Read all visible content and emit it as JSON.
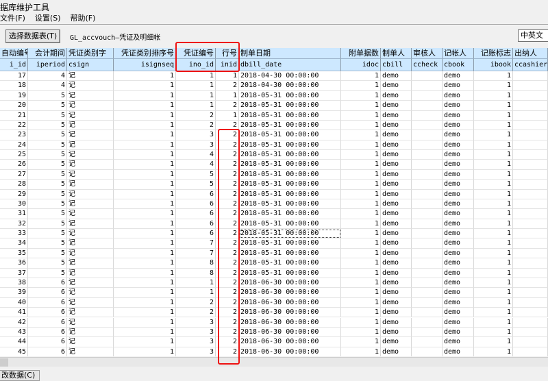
{
  "window": {
    "title": "据库维护工具"
  },
  "menu": [
    "文件(F)",
    "设置(S)",
    "帮助(F)"
  ],
  "toolbar": {
    "select_table": "选择数据表(T)",
    "table_name": "GL_accvouch—凭证及明细帐",
    "language": "中英文"
  },
  "columns": [
    {
      "cn": "自动编号",
      "en": "i_id",
      "align": "r"
    },
    {
      "cn": "会计期间",
      "en": "iperiod",
      "align": "r"
    },
    {
      "cn": "凭证类别字",
      "en": "csign",
      "align": "l"
    },
    {
      "cn": "凭证类别排序号",
      "en": "isignseq",
      "align": "r"
    },
    {
      "cn": "凭证编号",
      "en": "ino_id",
      "align": "r"
    },
    {
      "cn": "行号",
      "en": "inid",
      "align": "r"
    },
    {
      "cn": "制单日期",
      "en": "dbill_date",
      "align": "l"
    },
    {
      "cn": "附单据数",
      "en": "idoc",
      "align": "r"
    },
    {
      "cn": "制单人",
      "en": "cbill",
      "align": "l"
    },
    {
      "cn": "审核人",
      "en": "ccheck",
      "align": "l"
    },
    {
      "cn": "记帐人",
      "en": "cbook",
      "align": "l"
    },
    {
      "cn": "记账标志",
      "en": "ibook",
      "align": "r"
    },
    {
      "cn": "出纳人",
      "en": "ccashier",
      "align": "l"
    }
  ],
  "rows": [
    [
      "17",
      "4",
      "记",
      "1",
      "1",
      "1",
      "2018-04-30 00:00:00",
      "1",
      "demo",
      "",
      "demo",
      "1",
      ""
    ],
    [
      "18",
      "4",
      "记",
      "1",
      "1",
      "2",
      "2018-04-30 00:00:00",
      "1",
      "demo",
      "",
      "demo",
      "1",
      ""
    ],
    [
      "19",
      "5",
      "记",
      "1",
      "1",
      "1",
      "2018-05-31 00:00:00",
      "1",
      "demo",
      "",
      "demo",
      "1",
      ""
    ],
    [
      "20",
      "5",
      "记",
      "1",
      "1",
      "2",
      "2018-05-31 00:00:00",
      "1",
      "demo",
      "",
      "demo",
      "1",
      ""
    ],
    [
      "21",
      "5",
      "记",
      "1",
      "2",
      "1",
      "2018-05-31 00:00:00",
      "1",
      "demo",
      "",
      "demo",
      "1",
      ""
    ],
    [
      "22",
      "5",
      "记",
      "1",
      "2",
      "2",
      "2018-05-31 00:00:00",
      "1",
      "demo",
      "",
      "demo",
      "1",
      ""
    ],
    [
      "23",
      "5",
      "记",
      "1",
      "3",
      "2",
      "2018-05-31 00:00:00",
      "1",
      "demo",
      "",
      "demo",
      "1",
      ""
    ],
    [
      "24",
      "5",
      "记",
      "1",
      "3",
      "2",
      "2018-05-31 00:00:00",
      "1",
      "demo",
      "",
      "demo",
      "1",
      ""
    ],
    [
      "25",
      "5",
      "记",
      "1",
      "4",
      "2",
      "2018-05-31 00:00:00",
      "1",
      "demo",
      "",
      "demo",
      "1",
      ""
    ],
    [
      "26",
      "5",
      "记",
      "1",
      "4",
      "2",
      "2018-05-31 00:00:00",
      "1",
      "demo",
      "",
      "demo",
      "1",
      ""
    ],
    [
      "27",
      "5",
      "记",
      "1",
      "5",
      "2",
      "2018-05-31 00:00:00",
      "1",
      "demo",
      "",
      "demo",
      "1",
      ""
    ],
    [
      "28",
      "5",
      "记",
      "1",
      "5",
      "2",
      "2018-05-31 00:00:00",
      "1",
      "demo",
      "",
      "demo",
      "1",
      ""
    ],
    [
      "29",
      "5",
      "记",
      "1",
      "6",
      "2",
      "2018-05-31 00:00:00",
      "1",
      "demo",
      "",
      "demo",
      "1",
      ""
    ],
    [
      "30",
      "5",
      "记",
      "1",
      "6",
      "2",
      "2018-05-31 00:00:00",
      "1",
      "demo",
      "",
      "demo",
      "1",
      ""
    ],
    [
      "31",
      "5",
      "记",
      "1",
      "6",
      "2",
      "2018-05-31 00:00:00",
      "1",
      "demo",
      "",
      "demo",
      "1",
      ""
    ],
    [
      "32",
      "5",
      "记",
      "1",
      "6",
      "2",
      "2018-05-31 00:00:00",
      "1",
      "demo",
      "",
      "demo",
      "1",
      ""
    ],
    [
      "33",
      "5",
      "记",
      "1",
      "6",
      "2",
      "2018-05-31 00:00:00",
      "1",
      "demo",
      "",
      "demo",
      "1",
      ""
    ],
    [
      "34",
      "5",
      "记",
      "1",
      "7",
      "2",
      "2018-05-31 00:00:00",
      "1",
      "demo",
      "",
      "demo",
      "1",
      ""
    ],
    [
      "35",
      "5",
      "记",
      "1",
      "7",
      "2",
      "2018-05-31 00:00:00",
      "1",
      "demo",
      "",
      "demo",
      "1",
      ""
    ],
    [
      "36",
      "5",
      "记",
      "1",
      "8",
      "2",
      "2018-05-31 00:00:00",
      "1",
      "demo",
      "",
      "demo",
      "1",
      ""
    ],
    [
      "37",
      "5",
      "记",
      "1",
      "8",
      "2",
      "2018-05-31 00:00:00",
      "1",
      "demo",
      "",
      "demo",
      "1",
      ""
    ],
    [
      "38",
      "6",
      "记",
      "1",
      "1",
      "2",
      "2018-06-30 00:00:00",
      "1",
      "demo",
      "",
      "demo",
      "1",
      ""
    ],
    [
      "39",
      "6",
      "记",
      "1",
      "1",
      "2",
      "2018-06-30 00:00:00",
      "1",
      "demo",
      "",
      "demo",
      "1",
      ""
    ],
    [
      "40",
      "6",
      "记",
      "1",
      "2",
      "2",
      "2018-06-30 00:00:00",
      "1",
      "demo",
      "",
      "demo",
      "1",
      ""
    ],
    [
      "41",
      "6",
      "记",
      "1",
      "2",
      "2",
      "2018-06-30 00:00:00",
      "1",
      "demo",
      "",
      "demo",
      "1",
      ""
    ],
    [
      "42",
      "6",
      "记",
      "1",
      "3",
      "2",
      "2018-06-30 00:00:00",
      "1",
      "demo",
      "",
      "demo",
      "1",
      ""
    ],
    [
      "43",
      "6",
      "记",
      "1",
      "3",
      "2",
      "2018-06-30 00:00:00",
      "1",
      "demo",
      "",
      "demo",
      "1",
      ""
    ],
    [
      "44",
      "6",
      "记",
      "1",
      "3",
      "2",
      "2018-06-30 00:00:00",
      "1",
      "demo",
      "",
      "demo",
      "1",
      ""
    ],
    [
      "45",
      "6",
      "记",
      "1",
      "3",
      "2",
      "2018-06-30 00:00:00",
      "1",
      "demo",
      "",
      "demo",
      "1",
      ""
    ]
  ],
  "bottom_tab": "改数据(C)",
  "colors": {
    "header_bg": "#cde8ff",
    "annotation": "#ee1111"
  }
}
